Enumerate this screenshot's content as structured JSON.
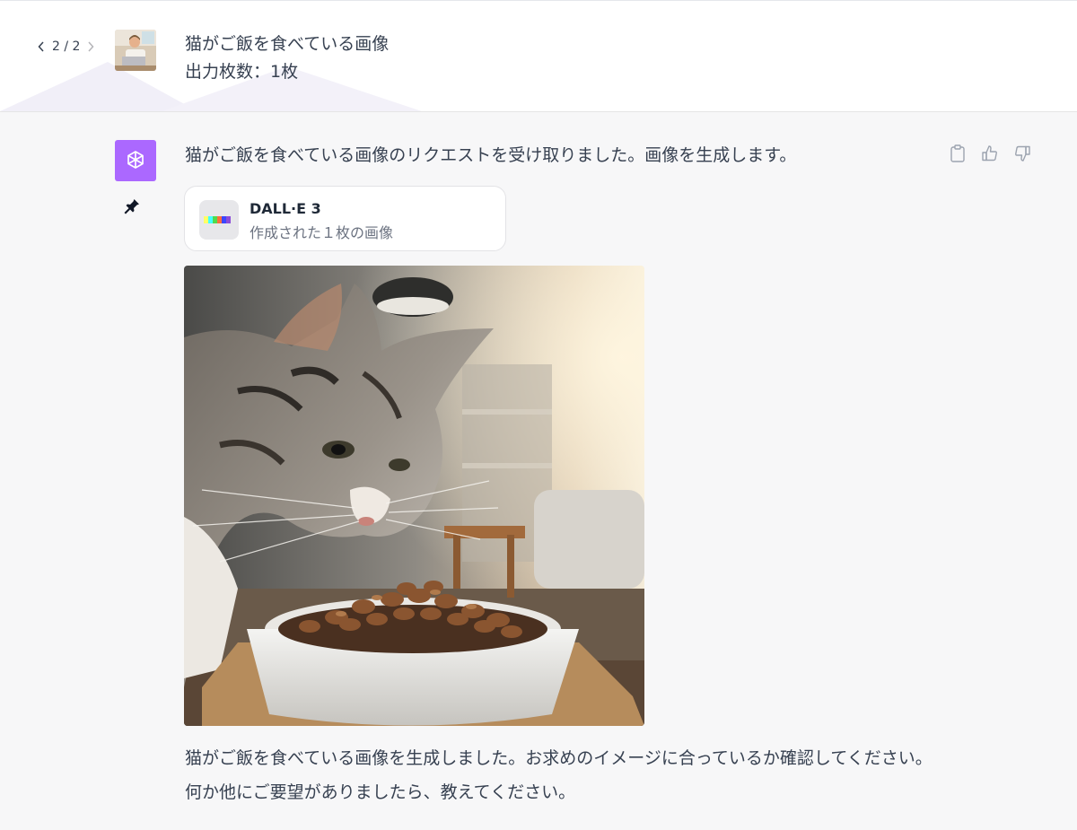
{
  "user_message": {
    "pager": "2 / 2",
    "line1": "猫がご飯を食べている画像",
    "line2": "出力枚数：1枚",
    "avatar_icon": "user-photo-avatar"
  },
  "assistant_message": {
    "avatar_icon": "openai-logo-icon",
    "pin_icon": "pin-icon",
    "intro": "猫がご飯を食べている画像のリクエストを受け取りました。画像を生成します。",
    "actions": [
      "clipboard-icon",
      "thumbs-up-icon",
      "thumbs-down-icon"
    ],
    "tool_card": {
      "title": "DALL·E 3",
      "subtitle": "作成された１枚の画像"
    },
    "image_alt": "cat-eating-food-image",
    "closing": "猫がご飯を食べている画像を生成しました。お求めのイメージに合っているか確認してください。何か他にご要望がありましたら、教えてください。"
  },
  "colors": {
    "assistant_avatar_bg": "#ab68ff",
    "page_bg": "#f7f7f8",
    "user_bg": "#ffffff",
    "text": "#374151"
  }
}
